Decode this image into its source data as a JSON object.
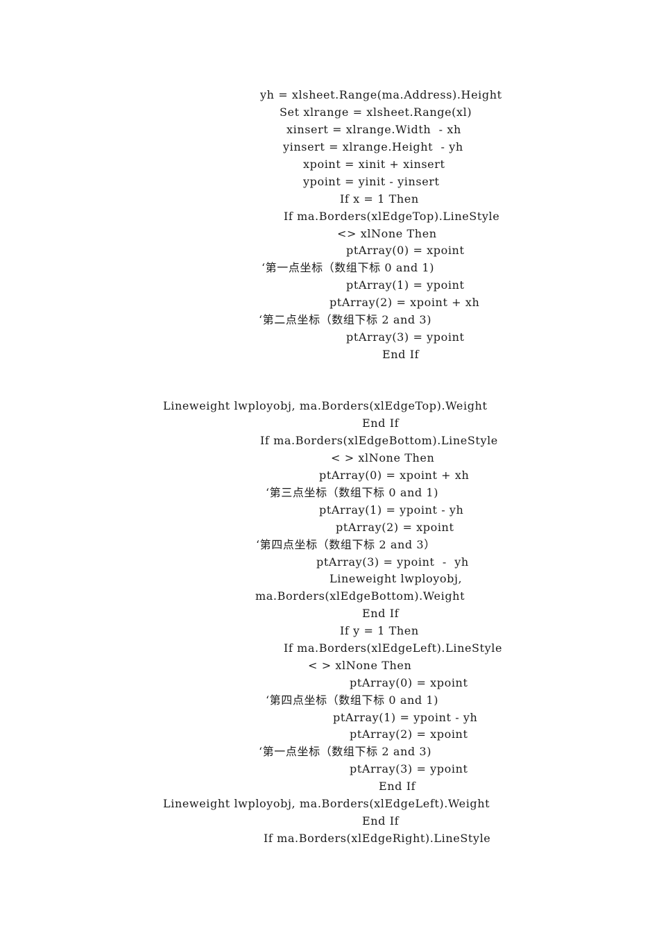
{
  "document": {
    "lines": [
      "yh = xlsheet.Range(ma.Address).Height",
      "Set xlrange = xlsheet.Range(xl)",
      "xinsert = xlrange.Width  - xh",
      "yinsert = xlrange.Height  - yh",
      "xpoint = xinit + xinsert",
      "ypoint = yinit - yinsert",
      "If x = 1 Then",
      "If ma.Borders(xlEdgeTop).LineStyle",
      "<> xlNone Then",
      "ptArray(0) = xpoint",
      "‘第一点坐标（数组下标 0 and 1)",
      "ptArray(1) = ypoint",
      "ptArray(2) = xpoint + xh",
      "‘第二点坐标（数组下标 2 and 3)",
      "ptArray(3) = ypoint",
      "End If",
      "Lineweight lwployobj, ma.Borders(xlEdgeTop).Weight",
      "End If",
      "If ma.Borders(xlEdgeBottom).LineStyle",
      "< > xlNone Then",
      "ptArray(0) = xpoint + xh",
      "‘第三点坐标（数组下标 0 and 1)",
      "ptArray(1) = ypoint - yh",
      "ptArray(2) = xpoint",
      "‘第四点坐标（数组下标 2 and 3）",
      "ptArray(3) = ypoint  -  yh",
      "Lineweight lwployobj,",
      "ma.Borders(xlEdgeBottom).Weight",
      "End If",
      "If y = 1 Then",
      "If ma.Borders(xlEdgeLeft).LineStyle",
      "< > xlNone Then",
      "ptArray(0) = xpoint",
      "‘第四点坐标（数组下标 0 and 1)",
      "ptArray(1) = ypoint - yh",
      "ptArray(2) = xpoint",
      "‘第一点坐标（数组下标 2 and 3)",
      "ptArray(3) = ypoint",
      "End If",
      "Lineweight lwployobj, ma.Borders(xlEdgeLeft).Weight",
      "End If",
      "If ma.Borders(xlEdgeRight).LineStyle"
    ]
  }
}
